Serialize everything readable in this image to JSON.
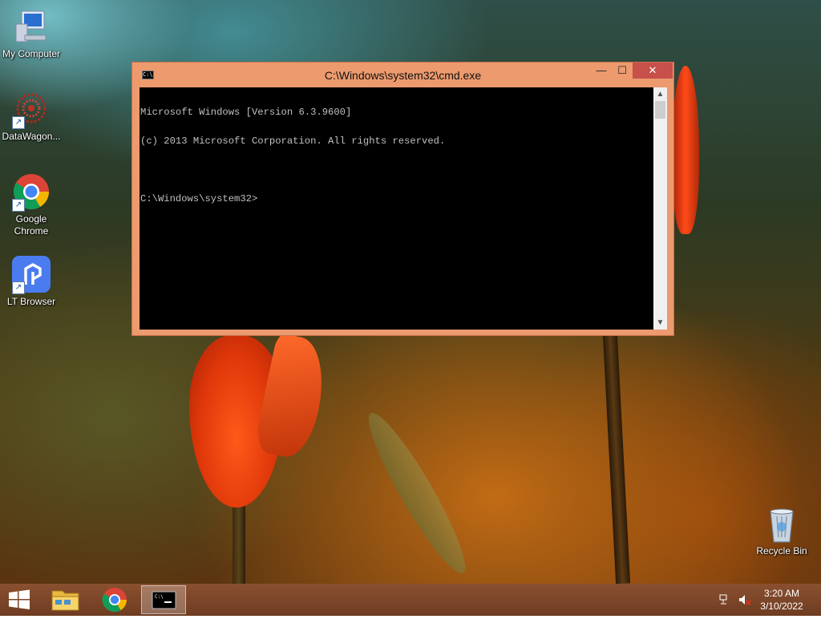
{
  "desktop": {
    "icons": [
      {
        "label": "My Computer"
      },
      {
        "label": "DataWagon..."
      },
      {
        "label": "Google Chrome"
      },
      {
        "label": "LT Browser"
      },
      {
        "label": "Recycle Bin"
      }
    ]
  },
  "cmd_window": {
    "title": "C:\\Windows\\system32\\cmd.exe",
    "icon_text": "C:\\",
    "minimize_glyph": "—",
    "maximize_glyph": "☐",
    "close_glyph": "✕",
    "console_lines": [
      "Microsoft Windows [Version 6.3.9600]",
      "(c) 2013 Microsoft Corporation. All rights reserved.",
      "",
      "C:\\Windows\\system32>"
    ]
  },
  "taskbar": {
    "clock_time": "3:20 AM",
    "clock_date": "3/10/2022",
    "items": [
      "start",
      "file-explorer",
      "chrome",
      "cmd"
    ]
  },
  "colors": {
    "window_frame": "#ec9a6e",
    "close_button": "#c7504a",
    "taskbar": "#7a4428",
    "console_bg": "#000000",
    "console_text": "#c0c0c0"
  }
}
